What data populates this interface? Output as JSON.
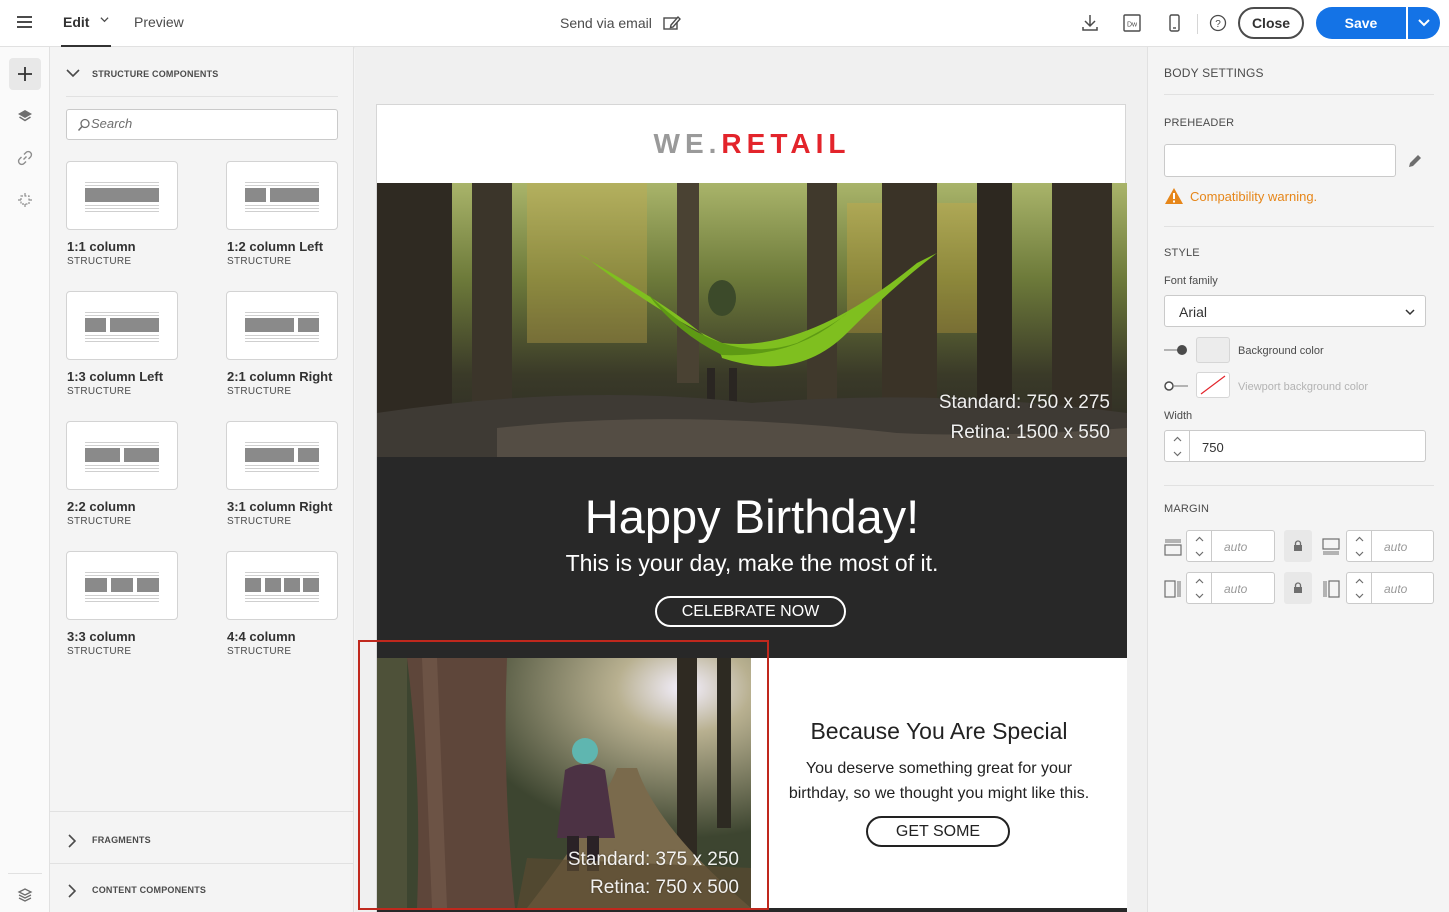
{
  "topbar": {
    "tabs": [
      {
        "label": "Edit"
      },
      {
        "label": "Preview"
      }
    ],
    "title": "Send via email",
    "close_label": "Close",
    "save_label": "Save",
    "colors": {
      "accent": "#1473e6"
    }
  },
  "left_panel": {
    "structure_header": "STRUCTURE COMPONENTS",
    "search_placeholder": "Search",
    "components": [
      {
        "name": "1:1 column",
        "type": "STRUCTURE"
      },
      {
        "name": "1:2 column Left",
        "type": "STRUCTURE"
      },
      {
        "name": "1:3 column Left",
        "type": "STRUCTURE"
      },
      {
        "name": "2:1 column Right",
        "type": "STRUCTURE"
      },
      {
        "name": "2:2 column",
        "type": "STRUCTURE"
      },
      {
        "name": "3:1 column Right",
        "type": "STRUCTURE"
      },
      {
        "name": "3:3 column",
        "type": "STRUCTURE"
      },
      {
        "name": "4:4 column",
        "type": "STRUCTURE"
      }
    ],
    "fragments_header": "FRAGMENTS",
    "content_header": "CONTENT COMPONENTS"
  },
  "email": {
    "logo_we": "WE.",
    "logo_retail": "RETAIL",
    "hero_caption_1": "Standard: 750 x 275",
    "hero_caption_2": "Retina: 1500 x 550",
    "banner_title": "Happy Birthday!",
    "banner_subtitle": "This is your day, make the most of it.",
    "banner_button": "CELEBRATE NOW",
    "image2_caption_1": "Standard: 375 x 250",
    "image2_caption_2": "Retina: 750 x 500",
    "special_title": "Because You Are Special",
    "special_text": "You deserve something great for your birthday, so we thought you might like this.",
    "special_button": "GET SOME"
  },
  "body_settings": {
    "header": "BODY SETTINGS",
    "preheader_label": "PREHEADER",
    "preheader_value": "",
    "warning": "Compatibility warning.",
    "style_label": "STYLE",
    "font_family_label": "Font family",
    "font_family_value": "Arial",
    "background_color_label": "Background color",
    "viewport_bg_label": "Viewport background color",
    "width_label": "Width",
    "width_value": "750",
    "margin_label": "MARGIN",
    "margin_top": "auto",
    "margin_bottom": "auto",
    "margin_left": "auto",
    "margin_right": "auto",
    "colors": {
      "warning": "#e68619",
      "selection": "#c0281d"
    }
  }
}
